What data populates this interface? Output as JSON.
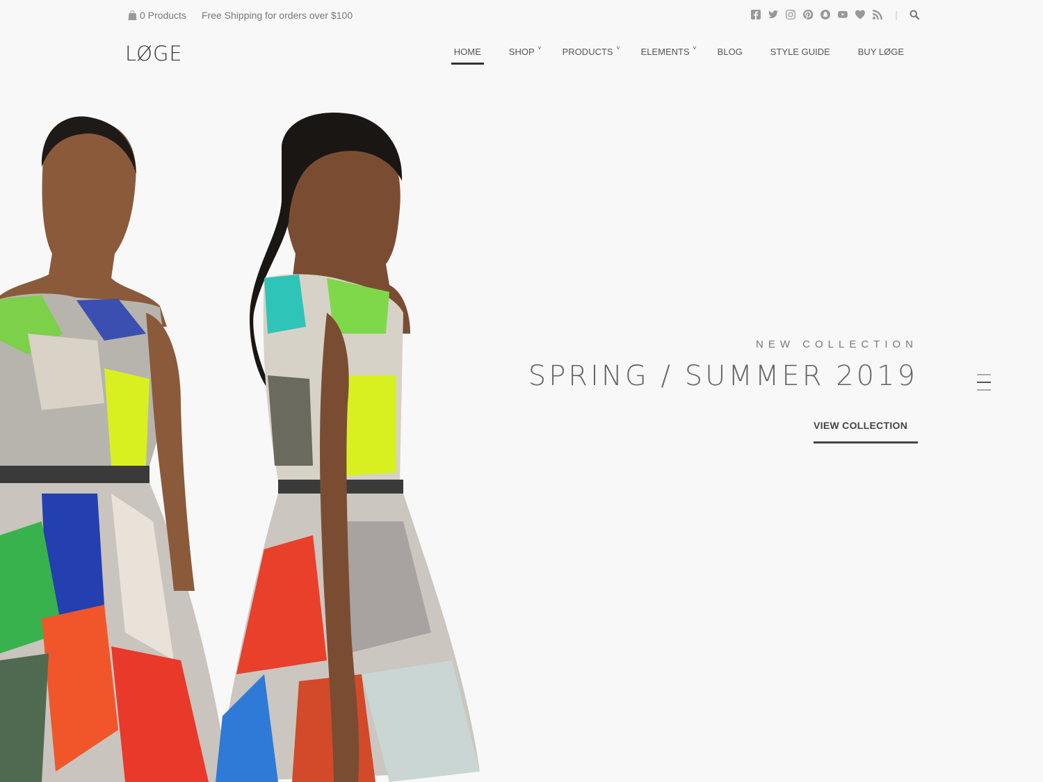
{
  "topbar": {
    "cart_count_label": "0 Products",
    "shipping_text": "Free Shipping for orders over $100",
    "social_icons": [
      "facebook-icon",
      "twitter-icon",
      "instagram-icon",
      "pinterest-icon",
      "snapchat-icon",
      "youtube-icon",
      "heart-icon",
      "rss-icon"
    ],
    "separator": "|"
  },
  "brand": {
    "logo_text": "LØGE"
  },
  "nav": {
    "items": [
      {
        "label": "HOME",
        "active": true,
        "dropdown": false
      },
      {
        "label": "SHOP",
        "active": false,
        "dropdown": true
      },
      {
        "label": "PRODUCTS",
        "active": false,
        "dropdown": true
      },
      {
        "label": "ELEMENTS",
        "active": false,
        "dropdown": true
      },
      {
        "label": "BLOG",
        "active": false,
        "dropdown": false
      },
      {
        "label": "STYLE GUIDE",
        "active": false,
        "dropdown": false
      },
      {
        "label": "BUY LØGE",
        "active": false,
        "dropdown": false
      }
    ],
    "caret": "˅"
  },
  "hero": {
    "kicker": "NEW COLLECTION",
    "headline": "SPRING / SUMMER 2019",
    "cta_label": "VIEW COLLECTION"
  },
  "colors": {
    "background": "#f8f8f8",
    "text": "#555555",
    "accent": "#333333"
  }
}
